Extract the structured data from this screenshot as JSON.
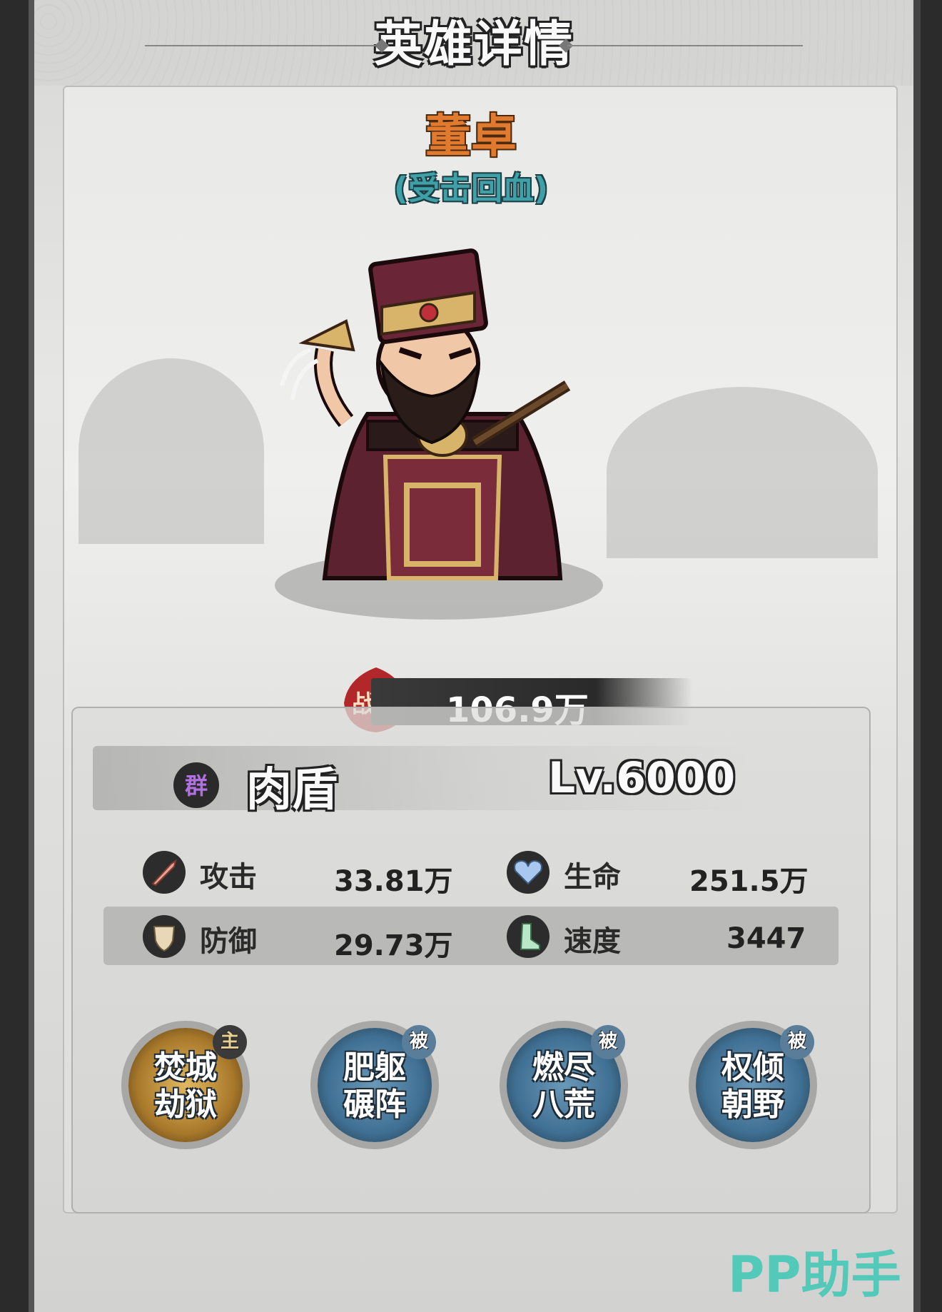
{
  "header": {
    "title": "英雄详情"
  },
  "hero": {
    "name": "董卓",
    "trait": "(受击回血)",
    "power_label": "战力",
    "power_value": "106.9万",
    "faction": "群",
    "class": "肉盾",
    "level": "Lv.6000"
  },
  "stats": [
    {
      "label": "攻击",
      "value": "33.81万",
      "icon": "sword-icon"
    },
    {
      "label": "生命",
      "value": "251.5万",
      "icon": "heart-icon"
    },
    {
      "label": "防御",
      "value": "29.73万",
      "icon": "shield-icon"
    },
    {
      "label": "速度",
      "value": "3447",
      "icon": "boot-icon"
    }
  ],
  "skills": [
    {
      "line1": "焚城",
      "line2": "劫狱",
      "badge": "主",
      "kind": "active"
    },
    {
      "line1": "肥躯",
      "line2": "碾阵",
      "badge": "被",
      "kind": "passive"
    },
    {
      "line1": "燃尽",
      "line2": "八荒",
      "badge": "被",
      "kind": "passive"
    },
    {
      "line1": "权倾",
      "line2": "朝野",
      "badge": "被",
      "kind": "passive"
    }
  ],
  "watermark": "PP助手",
  "colors": {
    "hero_name": "#e07a2e",
    "trait": "#3fa0a8",
    "active_skill": "#c9a24a",
    "passive_skill": "#3f6f92"
  }
}
